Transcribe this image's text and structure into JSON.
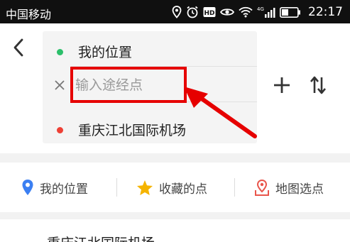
{
  "status_bar": {
    "carrier": "中国移动",
    "network_label": "4G",
    "time": "22:17"
  },
  "route": {
    "origin": "我的位置",
    "waypoint_placeholder": "输入途经点",
    "waypoint_value": "",
    "destination": "重庆江北国际机场"
  },
  "quick_options": [
    {
      "label": "我的位置",
      "icon": "location-pin-icon",
      "color": "#3b7ff2"
    },
    {
      "label": "收藏的点",
      "icon": "star-icon",
      "color": "#f5b400"
    },
    {
      "label": "地图选点",
      "icon": "map-pin-icon",
      "color": "#e9554b"
    }
  ],
  "result": {
    "title": "重庆江北国际机场"
  },
  "colors": {
    "origin_dot": "#2bbf6a",
    "destination_dot": "#ee4035",
    "annotation_red": "#e60000"
  }
}
